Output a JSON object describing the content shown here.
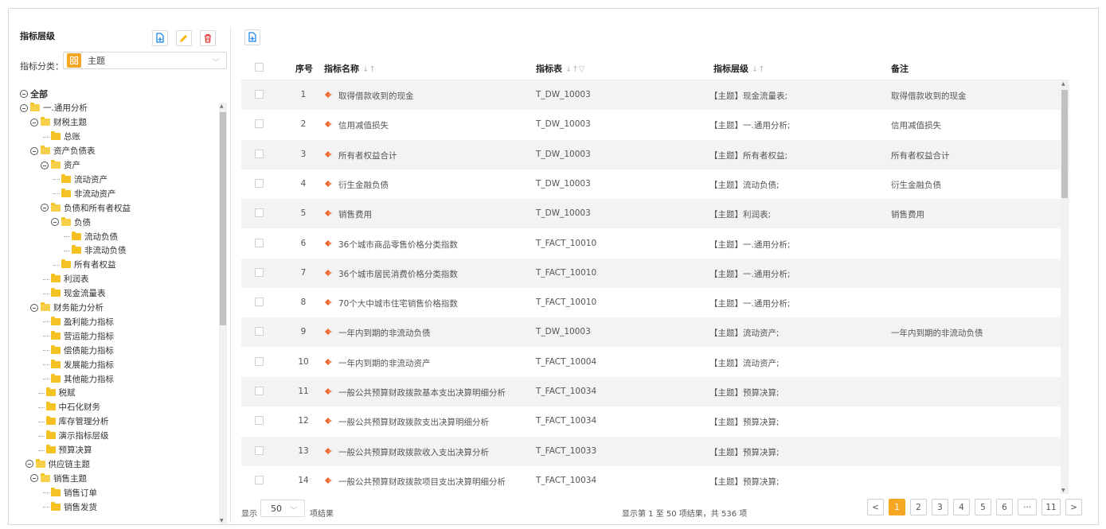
{
  "sidebar": {
    "title": "指标层级",
    "classify_label": "指标分类：",
    "classify_value": "主题",
    "tree": [
      {
        "label": "全部",
        "level": 0,
        "toggle": true,
        "folder": false,
        "bold": true
      },
      {
        "label": "一.通用分析",
        "level": 0,
        "toggle": true,
        "folder": true
      },
      {
        "label": "财税主题",
        "level": 1,
        "toggle": true,
        "folder": true
      },
      {
        "label": "总账",
        "level": 2,
        "toggle": false,
        "folder": true
      },
      {
        "label": "资产负债表",
        "level": 1,
        "toggle": true,
        "folder": true
      },
      {
        "label": "资产",
        "level": 2,
        "toggle": true,
        "folder": true
      },
      {
        "label": "流动资产",
        "level": 3,
        "toggle": false,
        "folder": true
      },
      {
        "label": "非流动资产",
        "level": 3,
        "toggle": false,
        "folder": true
      },
      {
        "label": "负债和所有者权益",
        "level": 2,
        "toggle": true,
        "folder": true
      },
      {
        "label": "负债",
        "level": 3,
        "toggle": true,
        "folder": true
      },
      {
        "label": "流动负债",
        "level": 4,
        "toggle": false,
        "folder": true
      },
      {
        "label": "非流动负债",
        "level": 4,
        "toggle": false,
        "folder": true
      },
      {
        "label": "所有者权益",
        "level": 3,
        "toggle": false,
        "folder": true
      },
      {
        "label": "利润表",
        "level": 2,
        "toggle": false,
        "folder": true
      },
      {
        "label": "现金流量表",
        "level": 2,
        "toggle": false,
        "folder": true
      },
      {
        "label": "财务能力分析",
        "level": 1,
        "toggle": true,
        "folder": true
      },
      {
        "label": "盈利能力指标",
        "level": 2,
        "toggle": false,
        "folder": true
      },
      {
        "label": "营运能力指标",
        "level": 2,
        "toggle": false,
        "folder": true
      },
      {
        "label": "偿债能力指标",
        "level": 2,
        "toggle": false,
        "folder": true
      },
      {
        "label": "发展能力指标",
        "level": 2,
        "toggle": false,
        "folder": true
      },
      {
        "label": "其他能力指标",
        "level": 2,
        "toggle": false,
        "folder": true
      },
      {
        "label": "税赋",
        "level": 1.5,
        "toggle": false,
        "folder": true
      },
      {
        "label": "中石化财务",
        "level": 1.5,
        "toggle": false,
        "folder": true
      },
      {
        "label": "库存管理分析",
        "level": 1.5,
        "toggle": false,
        "folder": true
      },
      {
        "label": "演示指标层级",
        "level": 1.5,
        "toggle": false,
        "folder": true
      },
      {
        "label": "预算决算",
        "level": 1.5,
        "toggle": false,
        "folder": true
      },
      {
        "label": "供应链主题",
        "level": 0.5,
        "toggle": true,
        "folder": true
      },
      {
        "label": "销售主题",
        "level": 1,
        "toggle": true,
        "folder": true
      },
      {
        "label": "销售订单",
        "level": 2,
        "toggle": false,
        "folder": true
      },
      {
        "label": "销售发货",
        "level": 2,
        "toggle": false,
        "folder": true
      }
    ]
  },
  "table": {
    "headers": {
      "index": "序号",
      "name": "指标名称",
      "table": "指标表",
      "level": "指标层级",
      "remark": "备注"
    },
    "rows": [
      {
        "index": "1",
        "name": "取得借款收到的现金",
        "table": "T_DW_10003",
        "level": "【主题】现金流量表;",
        "remark": "取得借款收到的现金"
      },
      {
        "index": "2",
        "name": "信用减值损失",
        "table": "T_DW_10003",
        "level": "【主题】一.通用分析;",
        "remark": "信用减值损失"
      },
      {
        "index": "3",
        "name": "所有者权益合计",
        "table": "T_DW_10003",
        "level": "【主题】所有者权益;",
        "remark": "所有者权益合计"
      },
      {
        "index": "4",
        "name": "衍生金融负债",
        "table": "T_DW_10003",
        "level": "【主题】流动负债;",
        "remark": "衍生金融负债"
      },
      {
        "index": "5",
        "name": "销售费用",
        "table": "T_DW_10003",
        "level": "【主题】利润表;",
        "remark": "销售费用"
      },
      {
        "index": "6",
        "name": "36个城市商品零售价格分类指数",
        "table": "T_FACT_10010",
        "level": "【主题】一.通用分析;",
        "remark": ""
      },
      {
        "index": "7",
        "name": "36个城市居民消费价格分类指数",
        "table": "T_FACT_10010",
        "level": "【主题】一.通用分析;",
        "remark": ""
      },
      {
        "index": "8",
        "name": "70个大中城市住宅销售价格指数",
        "table": "T_FACT_10010",
        "level": "【主题】一.通用分析;",
        "remark": ""
      },
      {
        "index": "9",
        "name": "一年内到期的非流动负债",
        "table": "T_DW_10003",
        "level": "【主题】流动资产;",
        "remark": "一年内到期的非流动负债"
      },
      {
        "index": "10",
        "name": "一年内到期的非流动资产",
        "table": "T_FACT_10004",
        "level": "【主题】流动资产;",
        "remark": ""
      },
      {
        "index": "11",
        "name": "一般公共预算财政拨款基本支出决算明细分析",
        "table": "T_FACT_10034",
        "level": "【主题】预算决算;",
        "remark": ""
      },
      {
        "index": "12",
        "name": "一般公共预算财政拨款支出决算明细分析",
        "table": "T_FACT_10034",
        "level": "【主题】预算决算;",
        "remark": ""
      },
      {
        "index": "13",
        "name": "一般公共预算财政拨款收入支出决算分析",
        "table": "T_FACT_10033",
        "level": "【主题】预算决算;",
        "remark": ""
      },
      {
        "index": "14",
        "name": "一般公共预算财政拨款项目支出决算明细分析",
        "table": "T_FACT_10034",
        "level": "【主题】预算决算;",
        "remark": ""
      }
    ]
  },
  "footer": {
    "show_label": "显示",
    "page_size": "50",
    "unit_label": "项结果",
    "summary": "显示第 1 至 50 项结果，共 536 项",
    "pages": [
      "1",
      "2",
      "3",
      "4",
      "5",
      "6",
      "···",
      "11"
    ],
    "prev": "<",
    "next": ">"
  },
  "colors": {
    "accent": "#f5a623",
    "add": "#1e88e5",
    "edit": "#f5b400",
    "delete": "#e53935",
    "diamond": "#f0642a",
    "folder": "#f5c224"
  }
}
